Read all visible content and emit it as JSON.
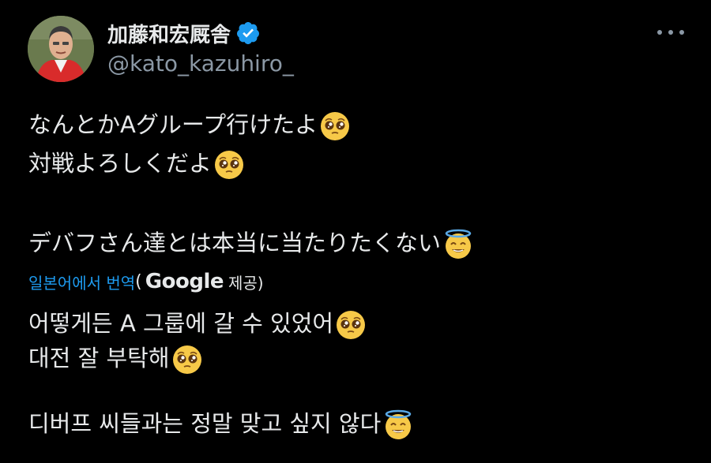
{
  "author": {
    "display_name": "加藤和宏厩舎",
    "handle": "@kato_kazuhiro_",
    "verified_icon": "verified-badge-icon"
  },
  "menu_icon": "more-options-icon",
  "tweet": {
    "ja_lines": [
      "なんとかAグループ行けたよ",
      "対戦よろしくだよ",
      "デバフさん達とは本当に当たりたくない"
    ],
    "translation": {
      "label": "일본어에서 번역",
      "paren_open": "(",
      "provider": "Google",
      "provided": "제공)"
    },
    "ko_lines": [
      "어떻게든 A 그룹에 갈 수 있었어",
      "대전 잘 부탁해",
      "디버프 씨들과는 정말 맞고 싶지 않다"
    ],
    "emojis": [
      "pleading-face",
      "pleading-face",
      "smiling-face-with-halo",
      "pleading-face",
      "pleading-face",
      "smiling-face-with-halo"
    ]
  }
}
